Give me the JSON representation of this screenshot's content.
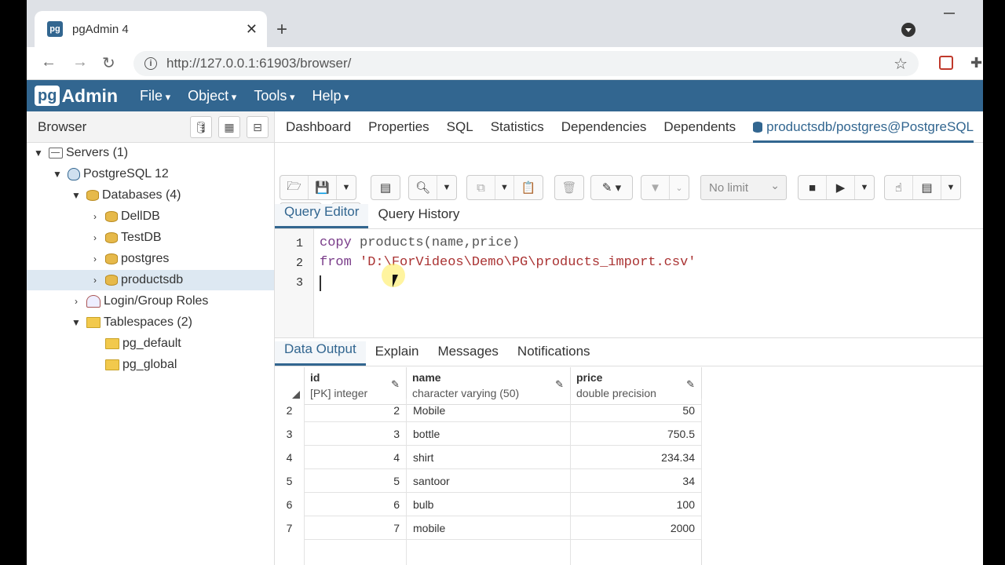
{
  "browser": {
    "tab_title": "pgAdmin 4",
    "favicon_text": "pg",
    "url": "http://127.0.0.1:61903/browser/"
  },
  "app": {
    "logo_pg": "pg",
    "logo_admin": "Admin",
    "menu": [
      "File",
      "Object",
      "Tools",
      "Help"
    ],
    "brand_color": "#326690"
  },
  "browser_panel": {
    "title": "Browser",
    "tree": [
      {
        "label": "Servers (1)",
        "icon": "server-icon"
      },
      {
        "label": "PostgreSQL 12",
        "icon": "postgres-elephant-icon"
      },
      {
        "label": "Databases (4)",
        "icon": "database-icon"
      },
      {
        "label": "DellDB",
        "icon": "database-icon"
      },
      {
        "label": "TestDB",
        "icon": "database-icon"
      },
      {
        "label": "postgres",
        "icon": "database-icon"
      },
      {
        "label": "productsdb",
        "icon": "database-icon",
        "selected": true
      },
      {
        "label": "Login/Group Roles",
        "icon": "roles-icon"
      },
      {
        "label": "Tablespaces (2)",
        "icon": "folder-icon"
      },
      {
        "label": "pg_default",
        "icon": "folder-icon"
      },
      {
        "label": "pg_global",
        "icon": "folder-icon"
      }
    ]
  },
  "main_tabs": [
    "Dashboard",
    "Properties",
    "SQL",
    "Statistics",
    "Dependencies",
    "Dependents",
    "productsdb/postgres@PostgreSQL"
  ],
  "toolbar": {
    "limit": "No limit"
  },
  "editor_tabs": [
    "Query Editor",
    "Query History"
  ],
  "editor": {
    "line_numbers": [
      "1",
      "2",
      "3"
    ],
    "line1_kw": "copy",
    "line1_rest": " products(name,price)",
    "line2_kw": "from",
    "line2_str": " 'D:\\ForVideos\\Demo\\PG\\products_import.csv'"
  },
  "output_tabs": [
    "Data Output",
    "Explain",
    "Messages",
    "Notifications"
  ],
  "grid": {
    "columns": [
      {
        "name": "id",
        "type": "[PK] integer"
      },
      {
        "name": "name",
        "type": "character varying (50)"
      },
      {
        "name": "price",
        "type": "double precision"
      }
    ],
    "rows": [
      {
        "rn": "2",
        "id": "2",
        "name": "Mobile",
        "price": "50"
      },
      {
        "rn": "3",
        "id": "3",
        "name": "bottle",
        "price": "750.5"
      },
      {
        "rn": "4",
        "id": "4",
        "name": "shirt",
        "price": "234.34"
      },
      {
        "rn": "5",
        "id": "5",
        "name": "santoor",
        "price": "34"
      },
      {
        "rn": "6",
        "id": "6",
        "name": "bulb",
        "price": "100"
      },
      {
        "rn": "7",
        "id": "7",
        "name": "mobile",
        "price": "2000"
      }
    ]
  }
}
